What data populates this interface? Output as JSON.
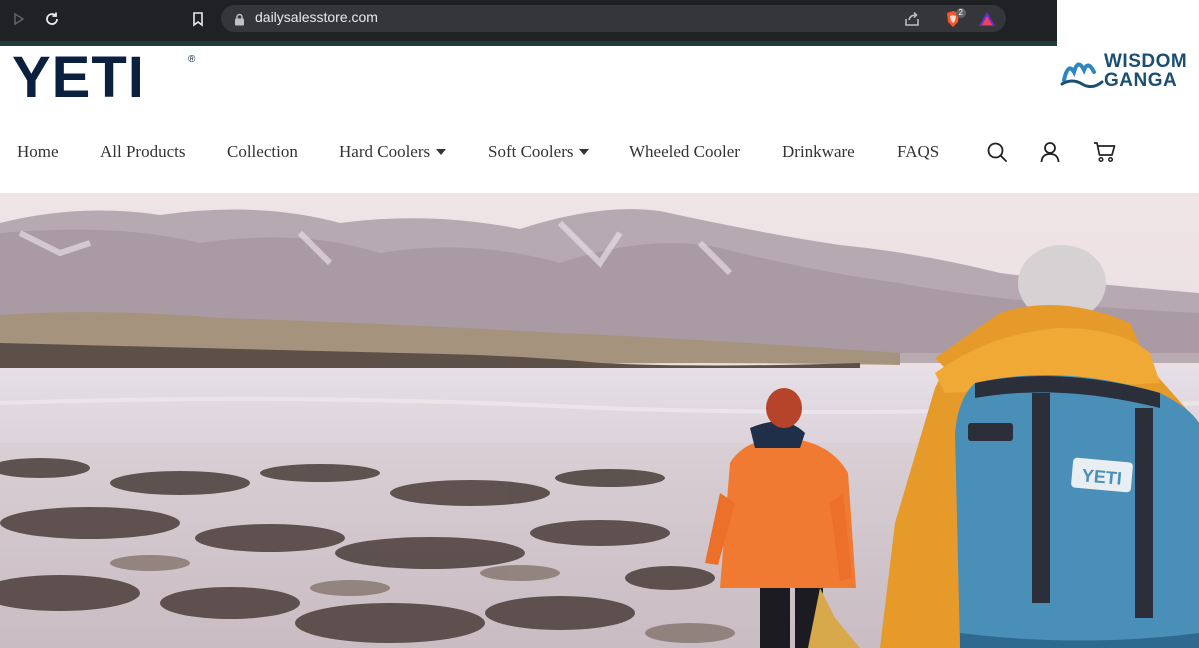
{
  "browser": {
    "url": "dailysalesstore.com",
    "extension_badge_count": "2"
  },
  "site": {
    "logo_text": "YETI",
    "logo_mark": "®"
  },
  "watermark": {
    "line1": "WISDOM",
    "line2": "GANGA"
  },
  "nav": {
    "items": [
      {
        "label": "Home"
      },
      {
        "label": "All Products"
      },
      {
        "label": "Collection"
      },
      {
        "label": "Hard Coolers",
        "dropdown": true
      },
      {
        "label": "Soft Coolers",
        "dropdown": true
      },
      {
        "label": "Wheeled Cooler"
      },
      {
        "label": "Drinkware"
      },
      {
        "label": "FAQS"
      }
    ],
    "icons": [
      "search-icon",
      "account-icon",
      "cart-icon"
    ]
  },
  "hero": {
    "bag_logo": "YETI"
  },
  "colors": {
    "brand_navy": "#0b1f3f",
    "chrome_bg": "#202124",
    "jacket_orange": "#f07a32",
    "jacket_amber": "#e69a2a",
    "bag_blue": "#4a8fb8"
  }
}
